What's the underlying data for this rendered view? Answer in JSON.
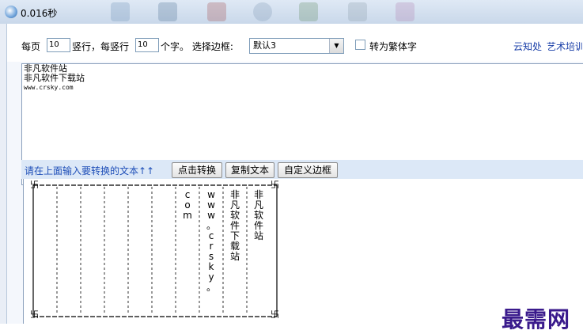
{
  "window": {
    "title": "0.016秒"
  },
  "options": {
    "per_page_label": "每页",
    "cols_value": "10",
    "cols_suffix": "竖行，每竖行",
    "chars_value": "10",
    "chars_suffix": "个字。 选择边框:",
    "border_select": "默认3",
    "traditional_label": "转为繁体字",
    "traditional_checked": false
  },
  "links": [
    "云知处",
    "艺术培训"
  ],
  "input": {
    "lines": [
      "非凡软件站",
      "非凡软件下载站",
      "www.crsky.com"
    ]
  },
  "buttons": {
    "prompt": "请在上面输入要转换的文本↑↑",
    "convert": "点击转换",
    "copy": "复制文本",
    "custom_border": "自定义边框"
  },
  "output": {
    "columns": [
      "非凡软件站",
      "非凡软件下载站",
      "www。crsky。",
      "com"
    ]
  },
  "watermark": "最需网"
}
